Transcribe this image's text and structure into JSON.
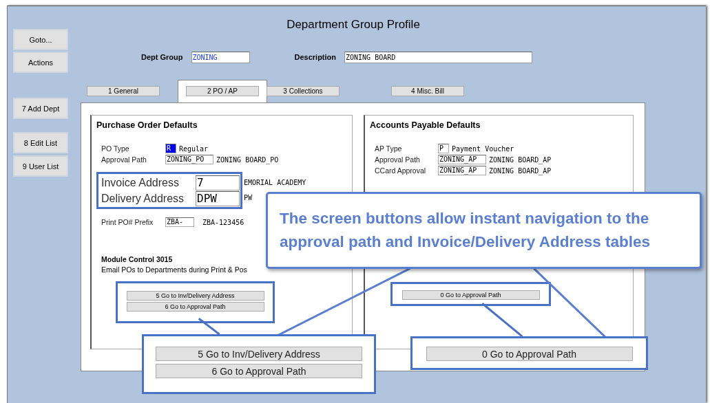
{
  "window": {
    "title": "Department Group Profile"
  },
  "side_buttons": [
    {
      "label": "Goto..."
    },
    {
      "label": "Actions"
    },
    {
      "label": "7 Add Dept"
    },
    {
      "label": "8 Edit List"
    },
    {
      "label": "9 User List"
    }
  ],
  "header": {
    "dept_group": {
      "label": "Dept Group",
      "value": "ZONING"
    },
    "description": {
      "label": "Description",
      "value": "ZONING BOARD"
    }
  },
  "tabs": [
    {
      "label": "1 General",
      "selected": false
    },
    {
      "label": "2 PO / AP",
      "selected": true
    },
    {
      "label": "3 Collections",
      "selected": false
    },
    {
      "label": "4 Misc. Bill",
      "selected": false
    }
  ],
  "po_defaults": {
    "title": "Purchase Order Defaults",
    "rows": [
      {
        "label": "PO Type",
        "value": "R",
        "text": "Regular",
        "focused": true
      },
      {
        "label": "Approval Path",
        "value": "ZONING_PO",
        "text": "ZONING BOARD_PO",
        "focused": false
      }
    ],
    "highlight_rows": [
      {
        "label": "Invoice Address",
        "value": "7",
        "text": "EMORIAL ACADEMY"
      },
      {
        "label": "Delivery Address",
        "value": "DPW",
        "text": "PW"
      }
    ],
    "prefix": {
      "label": "Print PO# Prefix",
      "value": "ZBA-",
      "text": "ZBA-123456"
    },
    "module_control": {
      "title": "Module Control 3015",
      "text": "Email POs to Departments during Print & Pos"
    },
    "buttons": [
      "5 Go to Inv/Delivery Address",
      "6 Go to Approval Path"
    ]
  },
  "ap_defaults": {
    "title": "Accounts Payable Defaults",
    "rows": [
      {
        "label": "AP Type",
        "value": "P",
        "text": "Payment Voucher",
        "focused": false
      },
      {
        "label": "Approval Path",
        "value": "ZONING_AP",
        "text": "ZONING BOARD_AP",
        "focused": false
      },
      {
        "label": "CCard Approval",
        "value": "ZONING_AP",
        "text": "ZONING BOARD_AP",
        "focused": false
      }
    ],
    "buttons": [
      "0 Go to Approval Path"
    ]
  },
  "callout": {
    "text": "The screen buttons allow instant navigation to the approval path and Invoice/Delivery Address tables"
  },
  "zoom_insets": [
    {
      "buttons": [
        "5 Go to Inv/Delivery Address",
        "6 Go to Approval Path"
      ]
    },
    {
      "buttons": [
        "0 Go to Approval Path"
      ]
    }
  ]
}
